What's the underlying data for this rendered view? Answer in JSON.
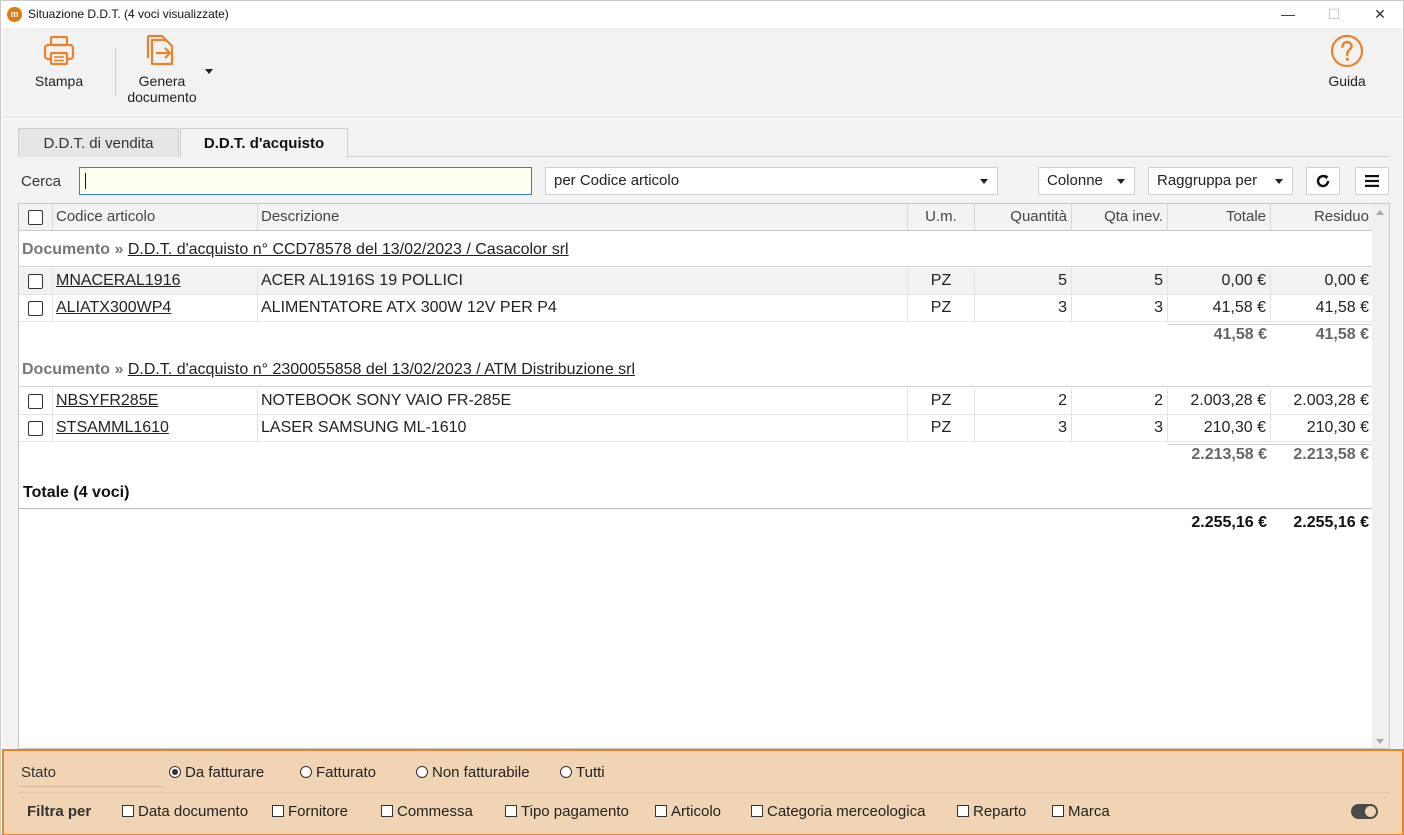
{
  "window": {
    "title": "Situazione D.D.T. (4 voci visualizzate)",
    "minimize": "—",
    "maximize": "☐",
    "close": "✕"
  },
  "toolbar": {
    "print_label": "Stampa",
    "generate_label_1": "Genera",
    "generate_label_2": "documento",
    "help_label": "Guida"
  },
  "tabs": [
    {
      "label": "D.D.T. di vendita",
      "active": false
    },
    {
      "label": "D.D.T. d'acquisto",
      "active": true
    }
  ],
  "search": {
    "label": "Cerca",
    "value": "",
    "mode": "per Codice articolo"
  },
  "buttons": {
    "columns": "Colonne",
    "group_by": "Raggruppa per",
    "refresh": "⟳",
    "menu": "≡"
  },
  "grid": {
    "headers": [
      "Codice articolo",
      "Descrizione",
      "U.m.",
      "Quantità",
      "Qta inev.",
      "Totale",
      "Residuo"
    ],
    "groups": [
      {
        "label": "Documento",
        "sep": "»",
        "title": "D.D.T. d'acquisto n° CCD78578 del 13/02/2023 / Casacolor srl",
        "rows": [
          {
            "code": "MNACERAL1916",
            "desc": "ACER AL1916S 19 POLLICI",
            "um": "PZ",
            "qty": "5",
            "qinev": "5",
            "total": "0,00 €",
            "residuo": "0,00 €"
          },
          {
            "code": "ALIATX300WP4",
            "desc": "ALIMENTATORE ATX 300W 12V PER  P4",
            "um": "PZ",
            "qty": "3",
            "qinev": "3",
            "total": "41,58 €",
            "residuo": "41,58 €"
          }
        ],
        "subtotal_total": "41,58 €",
        "subtotal_residuo": "41,58 €"
      },
      {
        "label": "Documento",
        "sep": "»",
        "title": "D.D.T. d'acquisto n° 2300055858 del 13/02/2023 / ATM Distribuzione srl",
        "rows": [
          {
            "code": "NBSYFR285E",
            "desc": "NOTEBOOK SONY VAIO FR-285E",
            "um": "PZ",
            "qty": "2",
            "qinev": "2",
            "total": "2.003,28 €",
            "residuo": "2.003,28 €"
          },
          {
            "code": "STSAMML1610",
            "desc": "LASER SAMSUNG ML-1610",
            "um": "PZ",
            "qty": "3",
            "qinev": "3",
            "total": "210,30 €",
            "residuo": "210,30 €"
          }
        ],
        "subtotal_total": "2.213,58 €",
        "subtotal_residuo": "2.213,58 €"
      }
    ],
    "grand_label": "Totale (4 voci)",
    "grand_total": "2.255,16 €",
    "grand_residuo": "2.255,16 €"
  },
  "filters": {
    "stato_label": "Stato",
    "stato_options": [
      {
        "label": "Da fatturare",
        "selected": true
      },
      {
        "label": "Fatturato",
        "selected": false
      },
      {
        "label": "Non fatturabile",
        "selected": false
      },
      {
        "label": "Tutti",
        "selected": false
      }
    ],
    "filtra_label": "Filtra per",
    "filtra_options": [
      "Data documento",
      "Fornitore",
      "Commessa",
      "Tipo pagamento",
      "Articolo",
      "Categoria merceologica",
      "Reparto",
      "Marca"
    ]
  },
  "colors": {
    "accent": "#e8832c",
    "bottom_bg": "#f0d4b3",
    "search_border": "#3a78d8"
  }
}
